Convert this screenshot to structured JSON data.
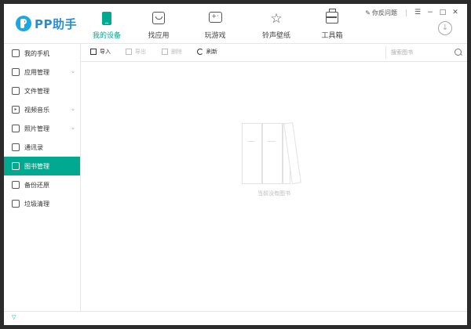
{
  "app": {
    "name": "PP助手"
  },
  "nav": {
    "items": [
      {
        "label": "我的设备",
        "icon": "phone-icon",
        "active": true
      },
      {
        "label": "找应用",
        "icon": "bag-icon",
        "active": false
      },
      {
        "label": "玩游戏",
        "icon": "gamepad-icon",
        "active": false
      },
      {
        "label": "铃声壁纸",
        "icon": "star-icon",
        "active": false
      },
      {
        "label": "工具箱",
        "icon": "toolbox-icon",
        "active": false
      }
    ]
  },
  "title_controls": {
    "feedback_label": "你反问题",
    "menu": "☰",
    "minimize": "−",
    "maximize": "□",
    "close": "✕"
  },
  "sidebar": {
    "items": [
      {
        "label": "我的手机",
        "icon": "phone-icon",
        "expandable": false,
        "active": false
      },
      {
        "label": "应用管理",
        "icon": "app-icon",
        "expandable": true,
        "active": false
      },
      {
        "label": "文件管理",
        "icon": "folder-icon",
        "expandable": false,
        "active": false
      },
      {
        "label": "视频音乐",
        "icon": "play-icon",
        "expandable": true,
        "active": false
      },
      {
        "label": "照片管理",
        "icon": "image-icon",
        "expandable": true,
        "active": false
      },
      {
        "label": "通讯录",
        "icon": "contacts-icon",
        "expandable": false,
        "active": false
      },
      {
        "label": "图书管理",
        "icon": "book-icon",
        "expandable": false,
        "active": true
      },
      {
        "label": "备份还原",
        "icon": "backup-icon",
        "expandable": false,
        "active": false
      },
      {
        "label": "垃圾清理",
        "icon": "trash-icon",
        "expandable": false,
        "active": false
      }
    ]
  },
  "toolbar": {
    "import_label": "导入",
    "export_label": "导出",
    "delete_label": "删除",
    "refresh_label": "刷新",
    "search_placeholder": "搜索图书"
  },
  "main": {
    "empty_text": "当前没有图书"
  },
  "colors": {
    "accent": "#00a98f",
    "brand": "#2a8dd4"
  }
}
